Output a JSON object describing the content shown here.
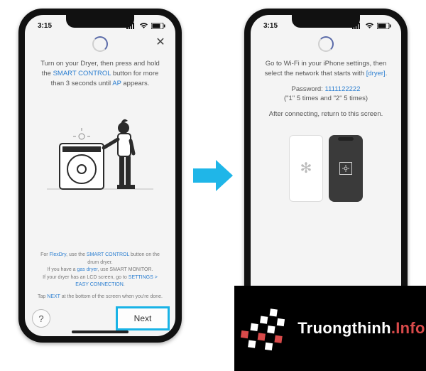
{
  "status": {
    "time": "3:15"
  },
  "screen1": {
    "instruction_pre": "Turn on your Dryer, then press and hold the ",
    "smart_control": "SMART CONTROL",
    "instruction_mid": " button for more than 3 seconds until ",
    "ap": "AP",
    "instruction_post": " appears.",
    "tip1_pre": "For ",
    "flexdry": "FlexDry",
    "tip1_mid": ", use the ",
    "tip1_hl": "SMART CONTROL",
    "tip1_post": " button on the drum dryer.",
    "tip2_pre": "If you have a ",
    "gas_dryer": "gas dryer",
    "tip2_post": ", use SMART MONITOR.",
    "tip3_pre": "If your dryer has an LCD screen, go to ",
    "settings_easy": "SETTINGS > EASY CONNECTION",
    "tip3_post": ".",
    "tip4_pre": "Tap ",
    "next_hl": "NEXT",
    "tip4_post": " at the bottom of the screen when you're done.",
    "help_label": "?",
    "next_label": "Next"
  },
  "screen2": {
    "line1": "Go to Wi-Fi in your iPhone settings, then select the network that starts with ",
    "dryer_hl": "[dryer]",
    "line1_post": ".",
    "pw_label": "Password: ",
    "pw_value": "1111122222",
    "pw_hint": "(\"1\" 5 times and \"2\" 5 times)",
    "line3": "After connecting, return to this screen."
  },
  "watermark": {
    "brand": "Truongthinh",
    "suffix": ".Info"
  }
}
